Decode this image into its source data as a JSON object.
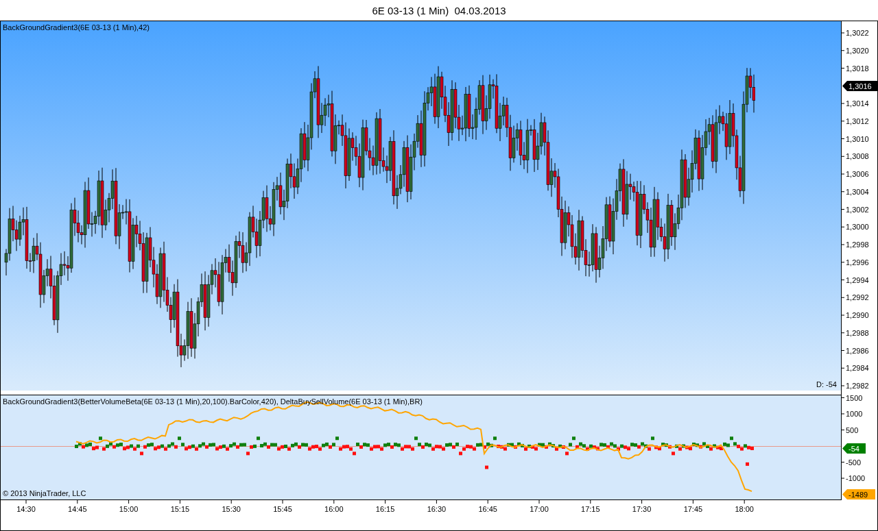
{
  "title": "6E 03-13 (1 Min)  04.03.2013",
  "price_panel": {
    "label": "BackGroundGradient3(6E 03-13 (1 Min),42)",
    "delta_label": "D: -54",
    "last_price": "1,3016",
    "y_ticks": [
      "1,3022",
      "1,3020",
      "1,3018",
      "1,3014",
      "1,3012",
      "1,3010",
      "1,3008",
      "1,3006",
      "1,3004",
      "1,3002",
      "1,3000",
      "1,2998",
      "1,2996",
      "1,2994",
      "1,2992",
      "1,2990",
      "1,2988",
      "1,2986",
      "1,2984",
      "1,2982"
    ]
  },
  "indicator_panel": {
    "label": "BackGroundGradient3(BetterVolumeBeta(6E 03-13 (1 Min),20,100).BarColor,420), DeltaBuySellVolume(6E 03-13 (1 Min),BR)",
    "copyright": "© 2013 NinjaTrader, LLC",
    "y_ticks": [
      "1500",
      "1000",
      "500",
      "-500",
      "-1000"
    ],
    "markers": [
      {
        "text": "-54",
        "color": "#008000"
      },
      {
        "text": "-1489",
        "color": "#ffa500"
      }
    ]
  },
  "time_axis": {
    "ticks": [
      "14:30",
      "14:45",
      "15:00",
      "15:15",
      "15:30",
      "15:45",
      "16:00",
      "16:15",
      "16:30",
      "16:45",
      "17:00",
      "17:15",
      "17:30",
      "17:45",
      "18:00"
    ]
  }
}
